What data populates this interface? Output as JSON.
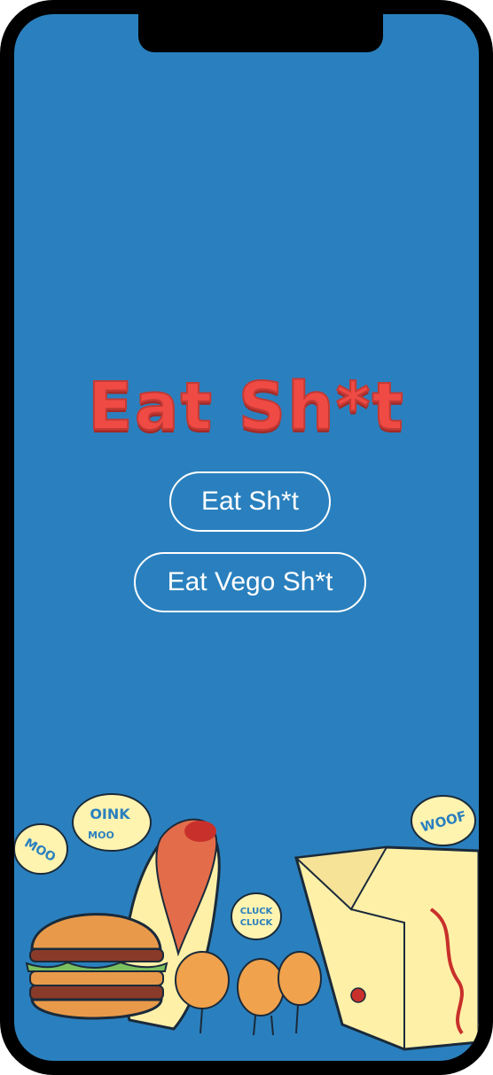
{
  "app": {
    "title": "Eat Sh*t"
  },
  "buttons": {
    "primary_label": "Eat Sh*t",
    "secondary_label": "Eat Vego Sh*t"
  },
  "illustration": {
    "bubbles": {
      "moo": "MOO",
      "oink": "OINK",
      "moo2": "MOO",
      "cluck": "CLUCK",
      "cluck2": "CLUCK",
      "woof": "WOOF"
    }
  },
  "colors": {
    "background": "#2a80be",
    "title": "#f04a45",
    "button_border": "#ffffff"
  }
}
